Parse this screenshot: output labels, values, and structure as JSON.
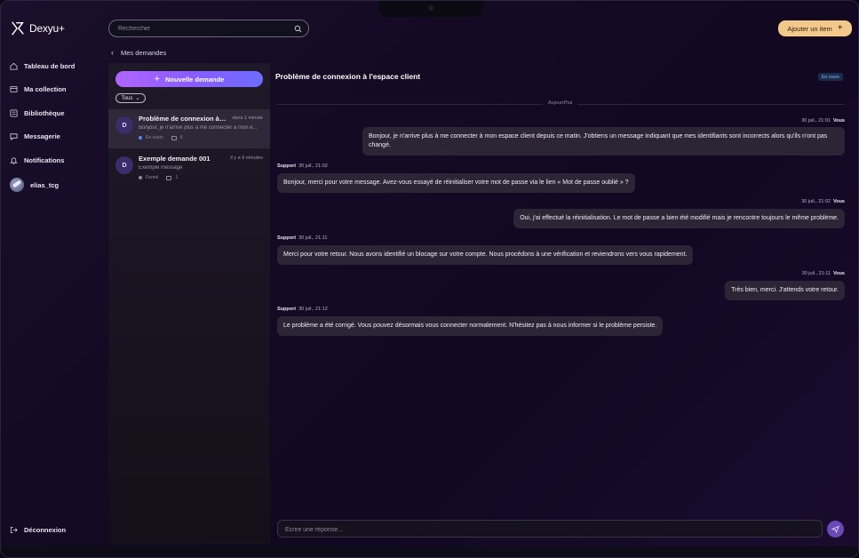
{
  "brand": {
    "name": "Dexyu+"
  },
  "search": {
    "placeholder": "Rechercher"
  },
  "header": {
    "add_item_label": "Ajouter un item"
  },
  "sidebar": {
    "items": [
      {
        "label": "Tableau de bord",
        "icon": "home-icon"
      },
      {
        "label": "Ma collection",
        "icon": "collection-icon"
      },
      {
        "label": "Bibliothèque",
        "icon": "library-icon"
      },
      {
        "label": "Messagerie",
        "icon": "message-icon"
      },
      {
        "label": "Notifications",
        "icon": "bell-icon"
      }
    ],
    "user": {
      "name": "elias_tcg"
    },
    "logout_label": "Déconnexion"
  },
  "requests_panel": {
    "back_label": "Mes demandes",
    "new_request_label": "Nouvelle demande",
    "filter_label": "Tous",
    "requests": [
      {
        "avatar": "D",
        "title": "Problème de connexion à l'e...",
        "time": "dans 1 minute",
        "preview": "Bonjour, je n'arrive plus à me connecter à mon e...",
        "status": "En cours",
        "status_color": "#4d8cff",
        "count": "6"
      },
      {
        "avatar": "D",
        "title": "Exemple demande 001",
        "time": "il y a 9 minutes",
        "preview": "Exemple message",
        "status": "Fermé",
        "status_color": "#8e8a9c",
        "count": "1"
      }
    ]
  },
  "conversation": {
    "title": "Problème de connexion à l'espace client",
    "status_badge": "En cours",
    "day_divider": "Aujourd'hui",
    "composer_placeholder": "Écrire une réponse...",
    "messages": [
      {
        "author": "Vous",
        "time": "30 juil., 21:01",
        "text": "Bonjour, je n'arrive plus à me connecter à mon espace client depuis ce matin. J'obtiens un message indiquant que mes identifiants sont incorrects alors qu'ils n'ont pas changé."
      },
      {
        "author": "Support",
        "time": "30 juil., 21:02",
        "text": "Bonjour, merci pour votre message. Avez-vous essayé de réinitialiser votre mot de passe via le lien « Mot de passe oublié » ?"
      },
      {
        "author": "Vous",
        "time": "30 juil., 21:02",
        "text": "Oui, j'ai effectué la réinitialisation. Le mot de passe a bien été modifié mais je rencontre toujours le même problème."
      },
      {
        "author": "Support",
        "time": "30 juil., 21:11",
        "text": "Merci pour votre retour. Nous avons identifié un blocage sur votre compte. Nous procédons à une vérification et reviendrons vers vous rapidement."
      },
      {
        "author": "Vous",
        "time": "30 juil., 21:11",
        "text": "Très bien, merci. J'attends votre retour."
      },
      {
        "author": "Support",
        "time": "30 juil., 21:12",
        "text": "Le problème a été corrigé. Vous pouvez désormais vous connecter normalement. N'hésitez pas à nous informer si le problème persiste."
      }
    ]
  }
}
